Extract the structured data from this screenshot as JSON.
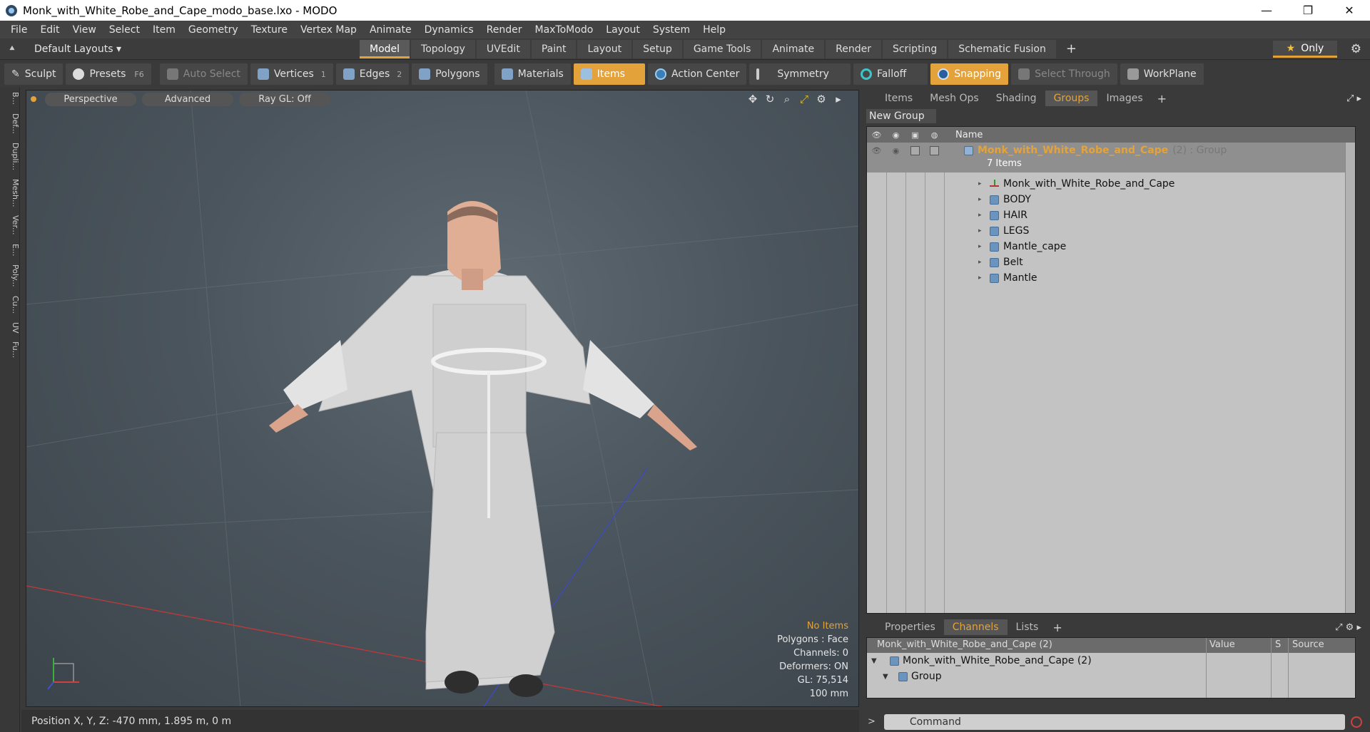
{
  "window": {
    "title": "Monk_with_White_Robe_and_Cape_modo_base.lxo - MODO",
    "controls": [
      "—",
      "❐",
      "✕"
    ]
  },
  "menu": [
    "File",
    "Edit",
    "View",
    "Select",
    "Item",
    "Geometry",
    "Texture",
    "Vertex Map",
    "Animate",
    "Dynamics",
    "Render",
    "MaxToModo",
    "Layout",
    "System",
    "Help"
  ],
  "layoutbar": {
    "layouts": "Default Layouts ▾",
    "tabs": [
      "Model",
      "Topology",
      "UVEdit",
      "Paint",
      "Layout",
      "Setup",
      "Game Tools",
      "Animate",
      "Render",
      "Scripting",
      "Schematic Fusion"
    ],
    "active_tab": "Model",
    "add": "+",
    "only": "Only"
  },
  "toolbar": {
    "sculpt": "Sculpt",
    "presets": "Presets",
    "presets_key": "F6",
    "auto_select": "Auto Select",
    "vertices": "Vertices",
    "vertices_num": "1",
    "edges": "Edges",
    "edges_num": "2",
    "polygons": "Polygons",
    "materials": "Materials",
    "items": "Items",
    "action_center": "Action Center",
    "symmetry": "Symmetry",
    "falloff": "Falloff",
    "snapping": "Snapping",
    "select_through": "Select Through",
    "workplane": "WorkPlane"
  },
  "leftstrip": [
    "B...",
    "Def...",
    "Dupli...",
    "Mesh...",
    "Ver...",
    "E...",
    "Poly...",
    "Cu...",
    "UV",
    "Fu..."
  ],
  "viewport": {
    "perspective": "Perspective",
    "advanced": "Advanced",
    "raygl": "Ray GL: Off",
    "hud": {
      "items": "No Items",
      "polygons": "Polygons : Face",
      "channels": "Channels: 0",
      "deformers": "Deformers: ON",
      "gl": "GL: 75,514",
      "scale": "100 mm"
    }
  },
  "status": {
    "position": "Position X, Y, Z:  -470 mm, 1.895 m, 0 m"
  },
  "groups_panel": {
    "tabs": [
      "Items",
      "Mesh Ops",
      "Shading",
      "Groups",
      "Images"
    ],
    "active_tab": "Groups",
    "add": "+",
    "new_group": "New Group",
    "col_name": "Name",
    "group": {
      "name": "Monk_with_White_Robe_and_Cape",
      "suffix": "(2) : Group",
      "count": "7 Items"
    },
    "children": [
      {
        "name": "Monk_with_White_Robe_and_Cape",
        "icon": "locator-icon"
      },
      {
        "name": "BODY",
        "icon": "mesh-icon"
      },
      {
        "name": "HAIR",
        "icon": "mesh-icon"
      },
      {
        "name": "LEGS",
        "icon": "mesh-icon"
      },
      {
        "name": "Mantle_cape",
        "icon": "mesh-icon"
      },
      {
        "name": "Belt",
        "icon": "mesh-icon"
      },
      {
        "name": "Mantle",
        "icon": "mesh-icon"
      }
    ]
  },
  "channels_panel": {
    "tabs": [
      "Properties",
      "Channels",
      "Lists"
    ],
    "active_tab": "Channels",
    "add": "+",
    "header": "Monk_with_White_Robe_and_Cape (2)",
    "col_value": "Value",
    "col_s": "S",
    "col_source": "Source",
    "rows": [
      "Monk_with_White_Robe_and_Cape (2)",
      "Group"
    ]
  },
  "command": {
    "prompt": ">",
    "placeholder": "Command"
  },
  "colors": {
    "accent": "#e3a33a",
    "panel": "#3a3a3a",
    "tree_bg": "#c3c3c3"
  }
}
